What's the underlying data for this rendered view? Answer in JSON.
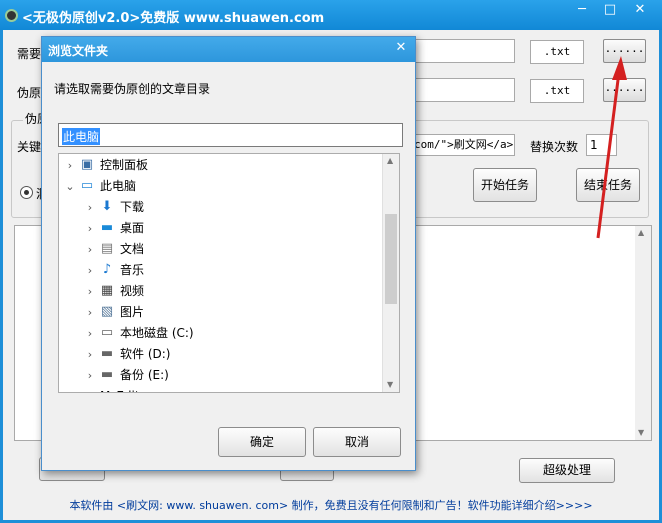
{
  "window": {
    "title": "<无极伪原创v2.0>免费版 www.shuawen.com",
    "min": "─",
    "max": "□",
    "close": "✕"
  },
  "main": {
    "row1_label": "需要",
    "row2_label": "伪原",
    "group_label": "伪原",
    "keyword_label": "关键",
    "ext1": ".txt",
    "ext2": ".txt",
    "dots1": "......",
    "dots2": "......",
    "link_text": "com/\">刷文网</a>",
    "replace_label": "替换次数",
    "replace_value": "1",
    "start_button": "开始任务",
    "stop_button": "结束任务",
    "radio_label": "洞",
    "super_button": "超级处理",
    "footer": "本软件由 <刷文网: www. shuawen. com> 制作，免费且没有任何限制和广告！软件功能详细介绍>>>>"
  },
  "dialog": {
    "title": "浏览文件夹",
    "close": "✕",
    "prompt": "请选取需要伪原创的文章目录",
    "path_value": "此电脑",
    "tree": [
      {
        "label": "控制面板",
        "icon": "control-panel-icon",
        "glyph": "▣",
        "color": "#3a6ea5",
        "expanded": false,
        "level": 0
      },
      {
        "label": "此电脑",
        "icon": "computer-icon",
        "glyph": "▭",
        "color": "#2a8ad8",
        "expanded": true,
        "level": 0
      },
      {
        "label": "下载",
        "icon": "download-icon",
        "glyph": "⬇",
        "color": "#1a78d0",
        "expanded": false,
        "level": 1
      },
      {
        "label": "桌面",
        "icon": "desktop-icon",
        "glyph": "▬",
        "color": "#1a8ad8",
        "expanded": false,
        "level": 1
      },
      {
        "label": "文档",
        "icon": "document-icon",
        "glyph": "▤",
        "color": "#777777",
        "expanded": false,
        "level": 1
      },
      {
        "label": "音乐",
        "icon": "music-icon",
        "glyph": "♪",
        "color": "#1a78d0",
        "expanded": false,
        "level": 1
      },
      {
        "label": "视频",
        "icon": "video-icon",
        "glyph": "▦",
        "color": "#444444",
        "expanded": false,
        "level": 1
      },
      {
        "label": "图片",
        "icon": "picture-icon",
        "glyph": "▧",
        "color": "#557799",
        "expanded": false,
        "level": 1
      },
      {
        "label": "本地磁盘 (C:)",
        "icon": "windows-drive-icon",
        "glyph": "▭",
        "color": "#666666",
        "expanded": false,
        "level": 1
      },
      {
        "label": "软件 (D:)",
        "icon": "drive-icon",
        "glyph": "▬",
        "color": "#666666",
        "expanded": false,
        "level": 1
      },
      {
        "label": "备份 (E:)",
        "icon": "drive-icon",
        "glyph": "▬",
        "color": "#666666",
        "expanded": false,
        "level": 1
      },
      {
        "label": "M_Edit...",
        "icon": "folder-icon",
        "glyph": "▬",
        "color": "#e8c050",
        "expanded": false,
        "level": 0
      }
    ],
    "ok_button": "确定",
    "cancel_button": "取消"
  },
  "colors": {
    "titlebar": "#1e8fd8",
    "accent_arrow": "#d42020",
    "selection": "#3390ff"
  }
}
